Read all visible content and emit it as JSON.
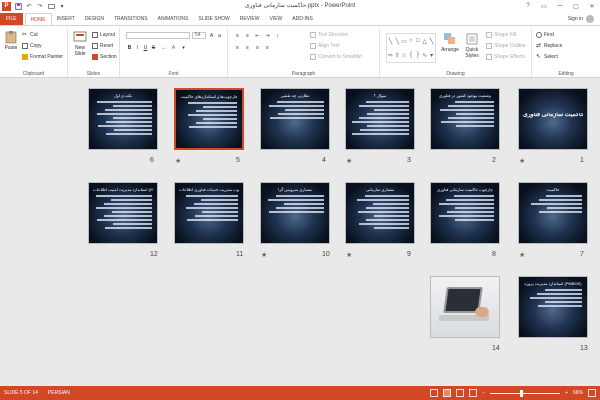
{
  "window": {
    "title": "حاکمیت سازمانی فناوری.pptx - PowerPoint",
    "app_letter": "P",
    "help": "?",
    "controls": [
      "▭",
      "—",
      "▢",
      "✕"
    ]
  },
  "tabs": [
    "FILE",
    "HOME",
    "INSERT",
    "DESIGN",
    "TRANSITIONS",
    "ANIMATIONS",
    "SLIDE SHOW",
    "REVIEW",
    "VIEW",
    "ADD-INS"
  ],
  "active_tab": "HOME",
  "user": {
    "signin": "Sign in"
  },
  "ribbon": {
    "clipboard": {
      "paste": "Paste",
      "cut": "Cut",
      "copy": "Copy",
      "format_painter": "Format Painter",
      "label": "Clipboard"
    },
    "slides": {
      "new_slide": "New Slide",
      "layout": "Layout",
      "reset": "Reset",
      "section": "Section",
      "label": "Slides"
    },
    "font": {
      "size": "54",
      "label": "Font",
      "bold": "B",
      "italic": "I",
      "underline": "U",
      "strike": "S"
    },
    "paragraph": {
      "text_direction": "Text Direction",
      "align_text": "Align Text",
      "smartart": "Convert to SmartArt",
      "label": "Paragraph"
    },
    "drawing": {
      "arrange": "Arrange",
      "quick_styles": "Quick Styles",
      "shape_fill": "Shape Fill",
      "shape_outline": "Shape Outline",
      "shape_effects": "Shape Effects",
      "label": "Drawing"
    },
    "editing": {
      "find": "Find",
      "replace": "Replace",
      "select": "Select",
      "label": "Editing"
    }
  },
  "slides": [
    {
      "num": "1",
      "title": "حاکمیت سازمانی فناوری",
      "kind": "title",
      "star": true
    },
    {
      "num": "2",
      "title": "وضعیت موجود کشور در فناوری",
      "kind": "text"
    },
    {
      "num": "3",
      "title": "سوال ؟",
      "kind": "text",
      "star": true
    },
    {
      "num": "4",
      "title": "نظارتی چه نقشی",
      "kind": "text"
    },
    {
      "num": "5",
      "title": "چارچوب‌ها و استانداردهای حاکمیت",
      "kind": "text",
      "selected": true,
      "star": true
    },
    {
      "num": "6",
      "title": "نکته ی اول",
      "kind": "text"
    },
    {
      "num": "7",
      "title": "حاکمیت",
      "kind": "text",
      "star": true
    },
    {
      "num": "8",
      "title": "چارچوب حاکمیت سازمانی فناوری",
      "kind": "text"
    },
    {
      "num": "9",
      "title": "معماری سازمانی",
      "kind": "text",
      "star": true
    },
    {
      "num": "10",
      "title": "معماری سرویس گرا",
      "kind": "text",
      "star": true
    },
    {
      "num": "11",
      "title": "چارچوب مدیریت خدمات فناوری اطلاعات (ITIL)",
      "kind": "text"
    },
    {
      "num": "12",
      "title": "استاندارد مدیریت امنیت اطلاعات (ISMS)",
      "kind": "text"
    },
    {
      "num": "13",
      "title": "استاندارد مدیریت پروژه (PMBOK)",
      "kind": "text"
    },
    {
      "num": "14",
      "title": "",
      "kind": "photo"
    }
  ],
  "status": {
    "slide_counter": "SLIDE 5 OF 14",
    "language": "PERSIAN",
    "zoom_percent": "66%",
    "zoom_fraction": 0.45
  },
  "colors": {
    "accent": "#d24726"
  }
}
